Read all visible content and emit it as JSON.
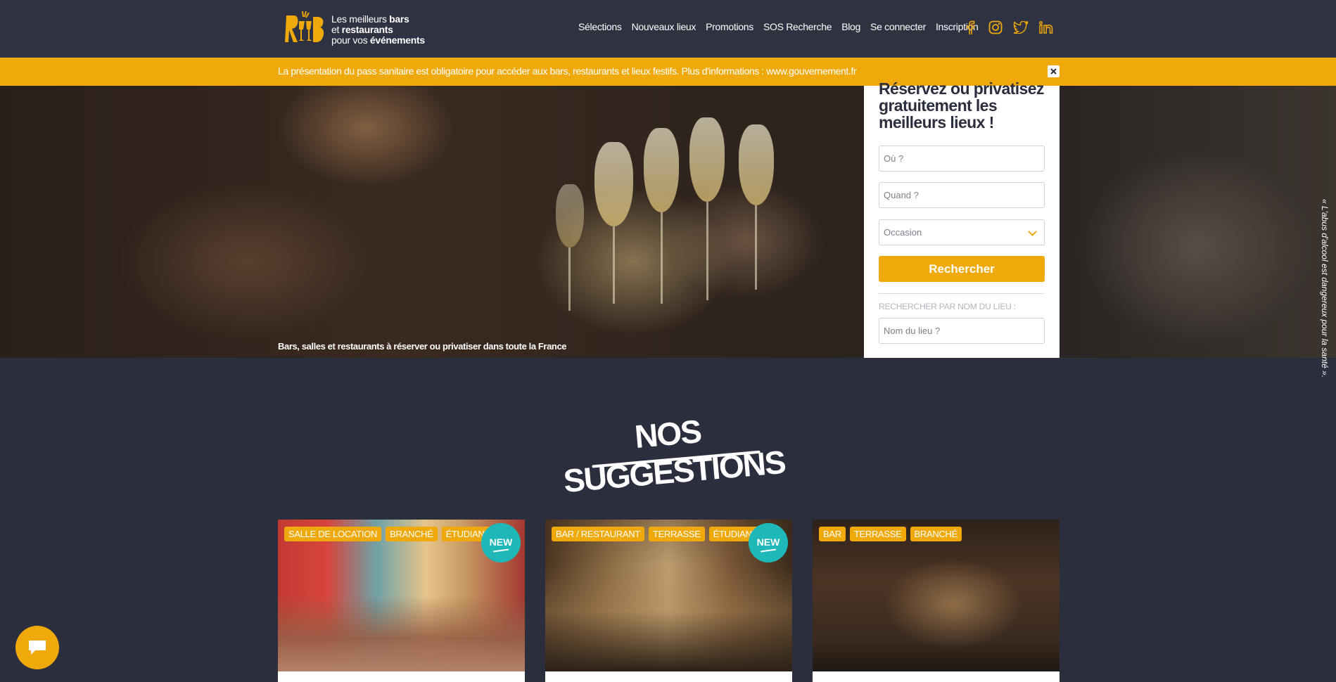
{
  "header": {
    "logo_letters": "RB",
    "logo_line1_pre": "Les meilleurs ",
    "logo_line1_bold": "bars",
    "logo_line2_pre": "et ",
    "logo_line2_bold": "restaurants",
    "logo_line3_pre": "pour vos ",
    "logo_line3_bold": "événements",
    "nav": [
      "Sélections",
      "Nouveaux lieux",
      "Promotions",
      "SOS Recherche",
      "Blog",
      "Se connecter",
      "Inscription"
    ],
    "socials": [
      "facebook-icon",
      "instagram-icon",
      "twitter-icon",
      "linkedin-icon"
    ]
  },
  "notice": {
    "text": "La présentation du pass sanitaire est obligatoire pour accéder aux bars, restaurants et lieux festifs. Plus d'informations : www.gouvernement.fr"
  },
  "hero": {
    "caption": "Bars, salles et restaurants à réserver ou privatiser dans toute la France",
    "side_warning": "« L'abus d'alcool est dangereux pour la santé »."
  },
  "search": {
    "title": "Réservez ou privatisez gratuitement les meilleurs lieux !",
    "where_placeholder": "Où ?",
    "when_placeholder": "Quand ?",
    "occasion_placeholder": "Occasion",
    "button": "Rechercher",
    "by_name_label": "RECHERCHER PAR NOM DU LIEU :",
    "name_placeholder": "Nom du lieu ?"
  },
  "suggestions": {
    "title": "NOS SUGGESTIONS",
    "cards": [
      {
        "tags": [
          "SALLE DE LOCATION",
          "BRANCHÉ",
          "ÉTUDIANT"
        ],
        "badge": "NEW"
      },
      {
        "tags": [
          "BAR / RESTAURANT",
          "TERRASSE",
          "ÉTUDIANT"
        ],
        "badge": "NEW"
      },
      {
        "tags": [
          "BAR",
          "TERRASSE",
          "BRANCHÉ"
        ],
        "badge": ""
      }
    ]
  },
  "colors": {
    "accent": "#f0a90b",
    "background": "#2b2f3d",
    "badge": "#1eb8b8"
  }
}
